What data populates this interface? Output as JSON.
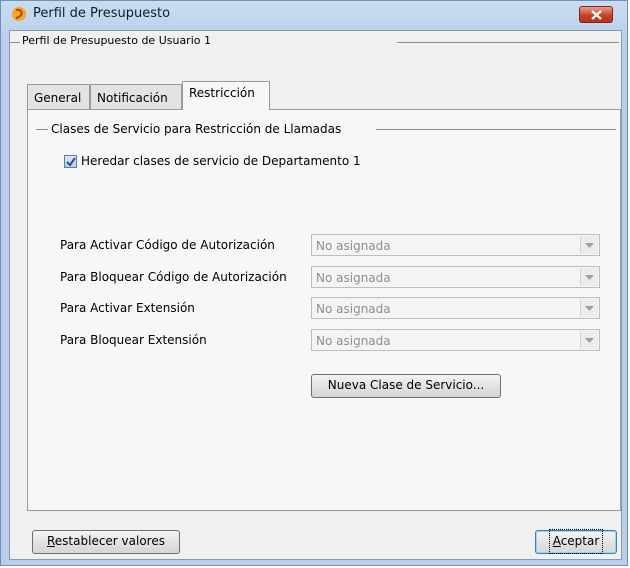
{
  "window": {
    "title": "Perfil de Presupuesto"
  },
  "profile_group": {
    "label": "Perfil de Presupuesto de Usuario 1"
  },
  "tabs": [
    {
      "label": "General",
      "active": false
    },
    {
      "label": "Notificación",
      "active": false
    },
    {
      "label": "Restricción",
      "active": true
    }
  ],
  "restriction": {
    "section_label": "Clases de Servicio para Restricción de Llamadas",
    "inherit_checkbox": {
      "label": "Heredar clases de servicio de Departamento 1",
      "checked": true
    },
    "rows": [
      {
        "label": "Para Activar Código de Autorización",
        "value": "No asignada"
      },
      {
        "label": "Para Bloquear Código de Autorización",
        "value": "No asignada"
      },
      {
        "label": "Para Activar Extensión",
        "value": "No asignada"
      },
      {
        "label": "Para Bloquear Extensión",
        "value": "No asignada"
      }
    ],
    "new_class_button": "Nueva Clase de Servicio..."
  },
  "footer": {
    "reset_mnemonic": "R",
    "reset_rest": "establecer valores",
    "accept_mnemonic": "A",
    "accept_rest": "ceptar"
  },
  "colors": {
    "titlebar": "#b9cfe9",
    "close_button": "#c8432a",
    "panel": "#f7f7f7",
    "checkbox_check": "#2b4f8a"
  }
}
